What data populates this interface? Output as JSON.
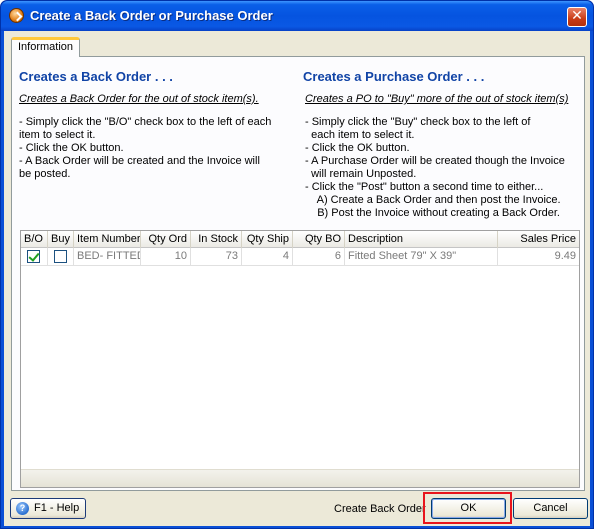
{
  "window": {
    "title": "Create a Back Order or Purchase Order",
    "close_glyph": "✕"
  },
  "tabs": [
    {
      "label": "Information"
    }
  ],
  "back_order": {
    "heading": "Creates a Back Order . . .",
    "subheading": "Creates a Back Order for the out of stock item(s).",
    "instructions": "- Simply click the \"B/O\" check box to the left of each\nitem to select it.\n- Click the OK button.\n- A Back Order will be created and the Invoice will\nbe posted."
  },
  "purchase_order": {
    "heading": "Creates a Purchase Order . . .",
    "subheading": "Creates a PO to \"Buy\" more of the out of stock item(s)",
    "instructions": "- Simply click the \"Buy\" check box to the left of\n  each item to select it.\n- Click the OK button.\n- A Purchase Order will be created though the Invoice\n  will remain Unposted.\n- Click the \"Post\" button a second time to either...\n    A) Create a Back Order and then post the Invoice.\n    B) Post the Invoice without creating a Back Order."
  },
  "grid": {
    "columns": [
      "B/O",
      "Buy",
      "Item Number",
      "Qty Ord",
      "In Stock",
      "Qty Ship",
      "Qty BO",
      "Description",
      "Sales Price"
    ],
    "rows": [
      {
        "bo_checked": true,
        "buy_checked": false,
        "item_number": "BED- FITTED",
        "qty_ord": "10",
        "in_stock": "73",
        "qty_ship": "4",
        "qty_bo": "6",
        "description": "Fitted Sheet 79\" X 39\"",
        "sales_price": "9.49"
      }
    ]
  },
  "footer": {
    "help_label": "F1 - Help",
    "help_icon_glyph": "?",
    "create_back_order_label": "Create Back Order",
    "ok_label": "OK",
    "cancel_label": "Cancel"
  },
  "colors": {
    "heading": "#1144a6",
    "highlight": "#e8141c",
    "titlebar": "#0554e0"
  }
}
